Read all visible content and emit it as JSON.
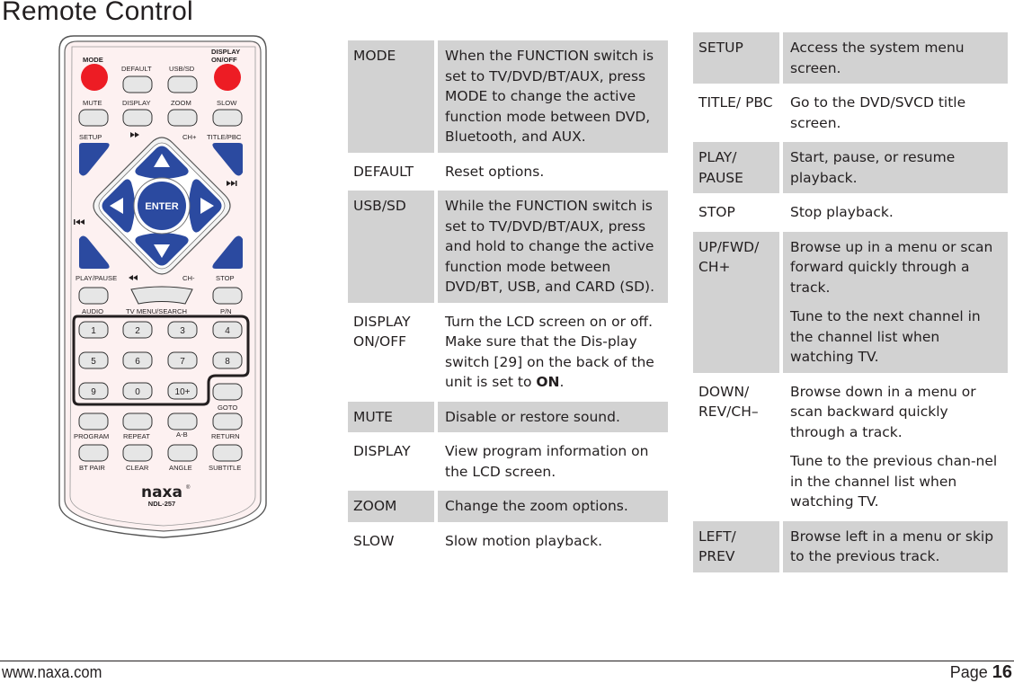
{
  "page": {
    "title": "Remote Control",
    "footer_url": "www.naxa.com",
    "footer_page_label": "Page",
    "footer_page_number": "16"
  },
  "remote": {
    "brand": "naxa",
    "model": "NDL-257",
    "labels": {
      "mode": "MODE",
      "display_onoff_1": "DISPLAY",
      "display_onoff_2": "ON/OFF",
      "default": "DEFAULT",
      "usbsd": "USB/SD",
      "mute": "MUTE",
      "display": "DISPLAY",
      "zoom": "ZOOM",
      "slow": "SLOW",
      "setup": "SETUP",
      "chplus": "CH+",
      "titlepbc": "TITLE/PBC",
      "enter": "ENTER",
      "playpause": "PLAY/PAUSE",
      "chminus": "CH-",
      "stop": "STOP",
      "audio": "AUDIO",
      "tvmenu": "TV MENU/SEARCH",
      "pn": "P/N",
      "goto": "GOTO",
      "program": "PROGRAM",
      "repeat": "REPEAT",
      "ab": "A-B",
      "return": "RETURN",
      "btpair": "BT PAIR",
      "clear": "CLEAR",
      "angle": "ANGLE",
      "subtitle": "SUBTITLE"
    },
    "numpad": [
      "1",
      "2",
      "3",
      "4",
      "5",
      "6",
      "7",
      "8",
      "9",
      "0",
      "10+"
    ],
    "colors": {
      "red": "#ed1c24",
      "blue": "#2b4aa0",
      "gray": "#e6e6e6",
      "body": "#fdf1f1"
    }
  },
  "table_left": [
    {
      "key": "MODE",
      "shaded": true,
      "desc": [
        "When the FUNCTION switch is set to TV/DVD/BT/AUX, press MODE to change the active function mode between DVD, Bluetooth, and AUX."
      ]
    },
    {
      "key": "DEFAULT",
      "shaded": false,
      "desc": [
        "Reset options."
      ]
    },
    {
      "key": "USB/SD",
      "shaded": true,
      "desc": [
        "While the FUNCTION switch is set to TV/DVD/BT/AUX, press and hold to change the active function mode between DVD/BT, USB, and CARD (SD)."
      ]
    },
    {
      "key": "DISPLAY ON/OFF",
      "shaded": false,
      "desc_pre": "Turn the LCD screen on or off.  Make sure that the Dis-play switch [29] on the back of the unit is set to ",
      "desc_bold": "ON",
      "desc_post": "."
    },
    {
      "key": "MUTE",
      "shaded": true,
      "desc": [
        "Disable or restore sound."
      ]
    },
    {
      "key": "DISPLAY",
      "shaded": false,
      "desc": [
        "View program information on the LCD screen."
      ]
    },
    {
      "key": "ZOOM",
      "shaded": true,
      "desc": [
        "Change the zoom options."
      ]
    },
    {
      "key": "SLOW",
      "shaded": false,
      "desc": [
        "Slow motion playback."
      ]
    }
  ],
  "table_right": [
    {
      "key": "SETUP",
      "shaded": true,
      "desc": [
        "Access the system menu screen."
      ]
    },
    {
      "key": "TITLE/ PBC",
      "shaded": false,
      "desc": [
        "Go to the DVD/SVCD title screen."
      ]
    },
    {
      "key": "PLAY/ PAUSE",
      "shaded": true,
      "desc": [
        "Start, pause, or resume playback."
      ]
    },
    {
      "key": "STOP",
      "shaded": false,
      "desc": [
        "Stop playback."
      ]
    },
    {
      "key": "UP/FWD/ CH+",
      "shaded": true,
      "desc": [
        "Browse up in a menu or scan forward quickly through a track.",
        "Tune to the next channel in the channel list when watching TV."
      ]
    },
    {
      "key": "DOWN/ REV/CH–",
      "shaded": false,
      "desc": [
        "Browse down in a menu or scan backward quickly through a track.",
        "Tune to the previous chan-nel in the channel list when watching TV."
      ]
    },
    {
      "key": "LEFT/ PREV",
      "shaded": true,
      "desc": [
        "Browse left in a menu or skip to the previous track."
      ]
    }
  ]
}
